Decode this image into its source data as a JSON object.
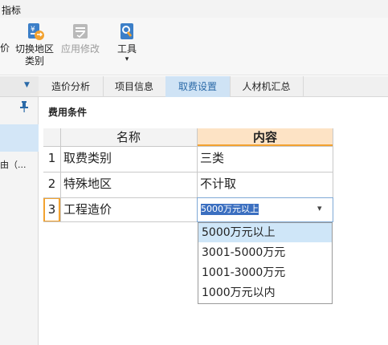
{
  "window": {
    "title": "指标"
  },
  "toolbar": {
    "partial_label": "价",
    "switch_region_label_line1": "切换地区",
    "switch_region_label_line2": "类别",
    "apply_changes_label": "应用修改",
    "tools_label": "工具",
    "tools_arrow": "▾"
  },
  "left_panel": {
    "collapse_arrow": "▼",
    "truncated_item": "由（..."
  },
  "tabs": [
    {
      "label": "造价分析"
    },
    {
      "label": "项目信息"
    },
    {
      "label": "取费设置"
    },
    {
      "label": "人材机汇总"
    }
  ],
  "section": {
    "title": "费用条件"
  },
  "table": {
    "headers": {
      "name": "名称",
      "content": "内容"
    },
    "rows": [
      {
        "index": "1",
        "name": "取费类别",
        "content": "三类"
      },
      {
        "index": "2",
        "name": "特殊地区",
        "content": "不计取"
      },
      {
        "index": "3",
        "name": "工程造价",
        "content": "5000万元以上"
      }
    ]
  },
  "dropdown": {
    "arrow": "▾",
    "options": [
      "5000万元以上",
      "3001-5000万元",
      "1001-3000万元",
      "1000万元以内"
    ],
    "highlighted_index": 0
  },
  "colors": {
    "accent": "#2b6aa8",
    "selected_tab_bg": "#cfe3f5",
    "content_header_bg": "#fde3c5",
    "row_highlight_bg": "#cfe6f8",
    "text_selection_bg": "#3b6fc0"
  }
}
